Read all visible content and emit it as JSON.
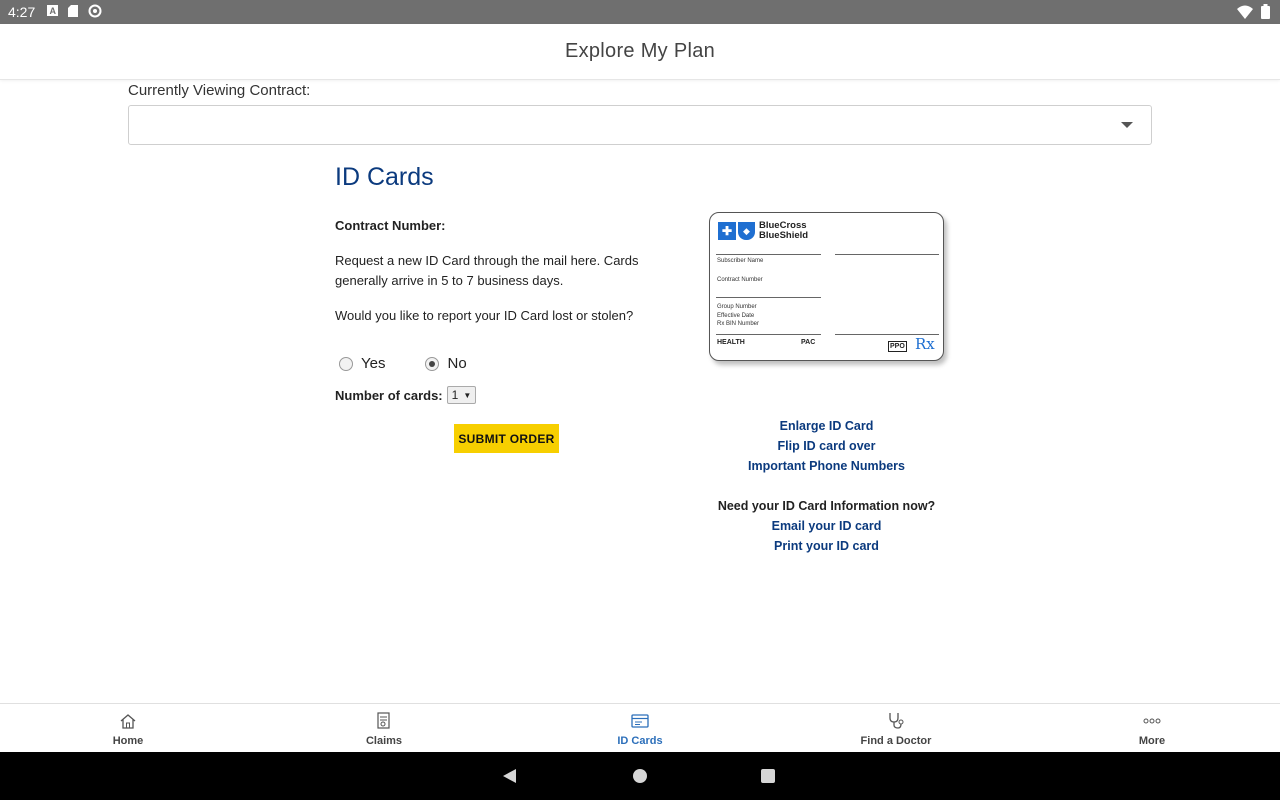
{
  "status_bar": {
    "time": "4:27"
  },
  "app_bar": {
    "title": "Explore My Plan"
  },
  "contract": {
    "label": "Currently Viewing Contract:",
    "selected": ""
  },
  "id_cards": {
    "heading": "ID Cards",
    "contract_number_label": "Contract Number:",
    "request_text": "Request a new ID Card through the mail here. Cards generally arrive in 5 to 7 business days.",
    "lost_question": "Would you like to report your ID Card lost or stolen?",
    "radio_yes": "Yes",
    "radio_no": "No",
    "selected_radio": "No",
    "number_label": "Number of cards:",
    "number_value": "1",
    "submit_label": "SUBMIT ORDER"
  },
  "card": {
    "logo_line1": "BlueCross",
    "logo_line2": "BlueShield",
    "subscriber_name": "Subscriber Name",
    "contract_number": "Contract Number",
    "group_number": "Group Number",
    "effective_date": "Effective Date",
    "rx_bin": "Rx BIN Number",
    "health": "HEALTH",
    "pac": "PAC",
    "ppo": "PPO",
    "rx": "Rx",
    "brand_color": "#1f6fd1"
  },
  "links": {
    "enlarge": "Enlarge ID Card",
    "flip": "Flip ID card over",
    "phone": "Important Phone Numbers",
    "need_now": "Need your ID Card Information now?",
    "email": "Email your ID card",
    "print": "Print your ID card"
  },
  "bottom_nav": {
    "items": [
      {
        "label": "Home",
        "icon": "home-icon"
      },
      {
        "label": "Claims",
        "icon": "claims-icon"
      },
      {
        "label": "ID Cards",
        "icon": "id-card-icon",
        "active": true
      },
      {
        "label": "Find a Doctor",
        "icon": "stethoscope-icon"
      },
      {
        "label": "More",
        "icon": "more-icon"
      }
    ],
    "active_color": "#2c6fba"
  }
}
